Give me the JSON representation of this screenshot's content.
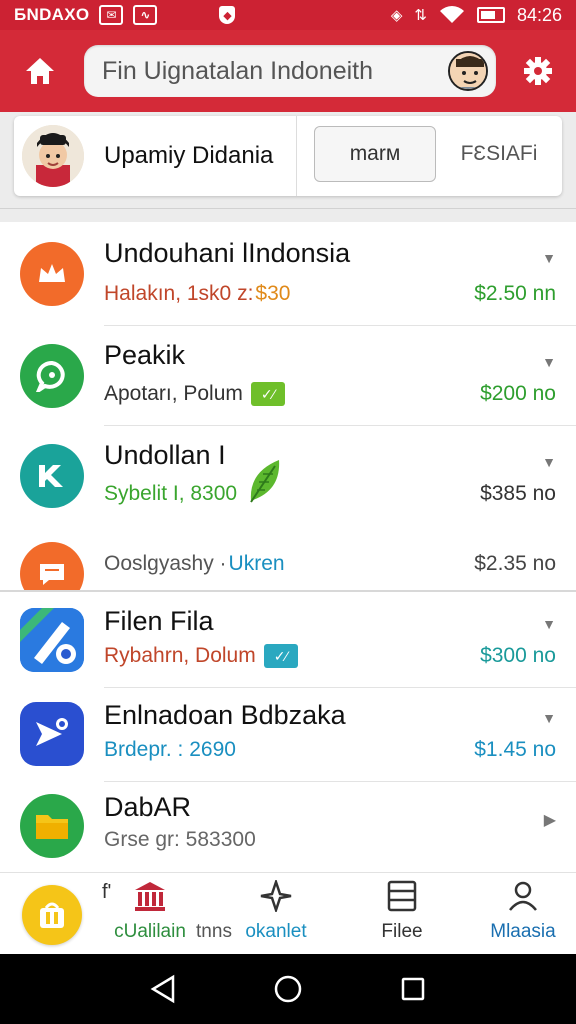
{
  "status_bar": {
    "carrier": "БNDAXO",
    "time": "84:26",
    "icons": [
      "mail-icon",
      "graph-icon",
      "shield-icon",
      "vibrate-icon",
      "data-icon",
      "wifi-icon",
      "battery-icon"
    ]
  },
  "app_bar": {
    "search_text": "Fin Uignatalan Indoneith",
    "icons": [
      "home-icon",
      "avatar",
      "gear-icon"
    ],
    "color": "#d42a38"
  },
  "profile": {
    "name": "Upamiy Didania",
    "primary_button": "marм",
    "secondary_button": "FƐSIAFi"
  },
  "list": [
    {
      "title": "Undouhani lIndonsia",
      "subtitle": "Halakın, 1sk0 z: ",
      "subtitle_accent": "$30",
      "price": "$2.50 nn",
      "price_color": "#2e9e2e",
      "subtitle_color": "#c0462a",
      "icon_color": "#f26b2a",
      "icon": "crown-icon"
    },
    {
      "title": "Peakik",
      "subtitle": "Apotarı, Polum",
      "badge": "✓⁄",
      "badge_color": "#6fbf2a",
      "price": "$200 no",
      "price_color": "#2e9e2e",
      "subtitle_color": "#333333",
      "icon_color": "#2aa84a",
      "icon": "chat-icon"
    },
    {
      "title": "Undollan I",
      "subtitle": "Sybelit I, 8300",
      "price": "$385 no",
      "price_color": "#333333",
      "subtitle_color": "#3aa52e",
      "icon_color": "#1aa39a",
      "icon": "tool-icon",
      "extra_icon": "leaf-icon"
    },
    {
      "title": "",
      "subtitle": "Ooslgyashy · ",
      "subtitle_accent": "Ukren",
      "price": "$2.35 no",
      "price_color": "#444444",
      "subtitle_color": "#555555",
      "icon_color": "#f26b2a",
      "icon": "message-icon"
    },
    {
      "title": "Filen Fila",
      "subtitle": "Rybahrn, Dolum",
      "badge": "✓⁄",
      "badge_color": "#2aa8c0",
      "price": "$300 no",
      "price_color": "#1a9a9a",
      "subtitle_color": "#c0462a",
      "icon_color": "#2a7ae0",
      "icon": "pen-icon"
    },
    {
      "title": "Enlnadoan Bdbzaka",
      "subtitle": "Brdepr. : 2690",
      "price": "$1.45 no",
      "price_color": "#1a8fc0",
      "subtitle_color": "#1a8fc0",
      "icon_color": "#2a4fd0",
      "icon": "send-icon"
    },
    {
      "title": "DabAR",
      "subtitle": "Grse gr: 583300",
      "price": "",
      "price_color": "#333333",
      "subtitle_color": "#666666",
      "icon_color": "#2aa84a",
      "icon": "folder-icon"
    }
  ],
  "bottom_nav": {
    "prefix": "f'",
    "tabs": [
      {
        "label": "cUalilain",
        "icon": "bank-icon",
        "color": "#2e8e3e"
      },
      {
        "label": "tnns",
        "icon": "",
        "color": "#555555"
      },
      {
        "label": "okanlet",
        "icon": "plane-icon",
        "color": "#1a8fc0"
      },
      {
        "label": "Filee",
        "icon": "list-icon",
        "color": "#333333"
      },
      {
        "label": "Mlaasia",
        "icon": "person-icon",
        "color": "#1a6fb0"
      }
    ],
    "fab_icon": "shop-icon"
  },
  "system_nav": [
    "back-icon",
    "home-circle-icon",
    "recents-icon"
  ]
}
